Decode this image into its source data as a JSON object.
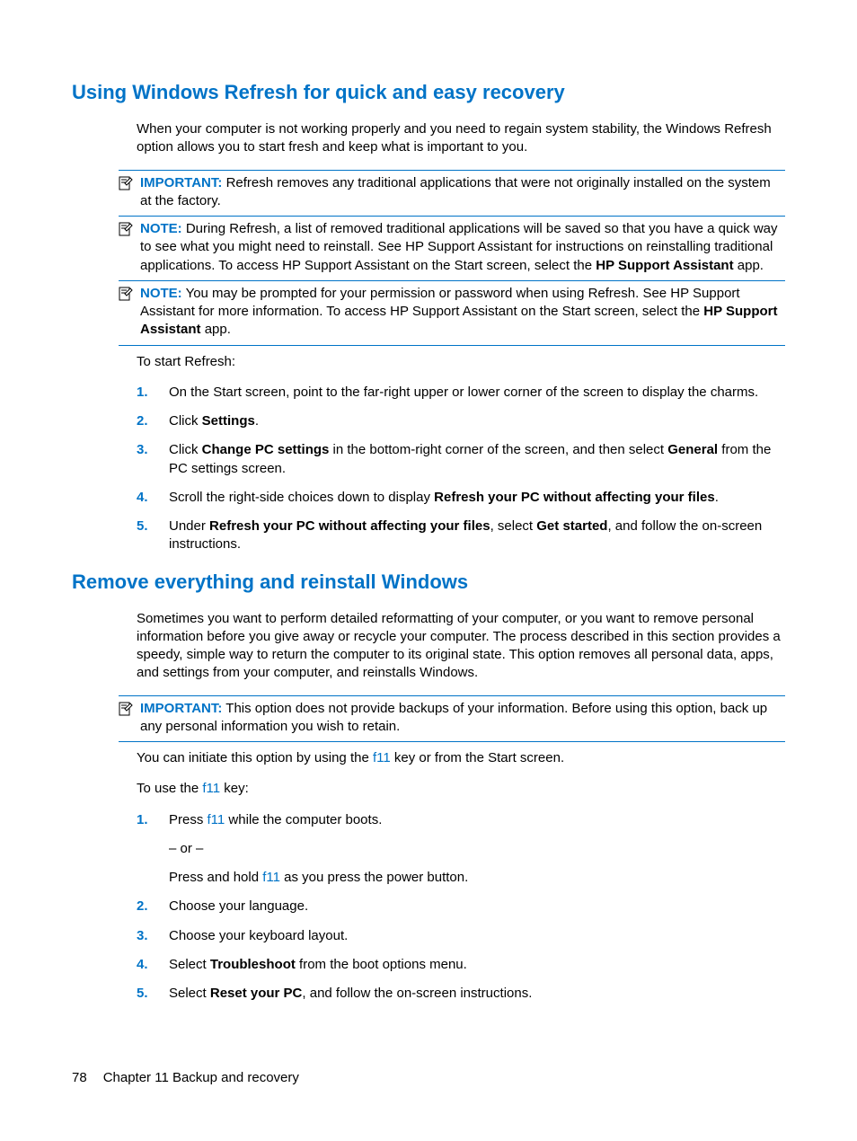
{
  "section1": {
    "heading": "Using Windows Refresh for quick and easy recovery",
    "intro": "When your computer is not working properly and you need to regain system stability, the Windows Refresh option allows you to start fresh and keep what is important to you.",
    "callouts": [
      {
        "label": "IMPORTANT:",
        "text_after": "Refresh removes any traditional applications that were not originally installed on the system at the factory."
      },
      {
        "label": "NOTE:",
        "text_after_part1": "During Refresh, a list of removed traditional applications will be saved so that you have a quick way to see what you might need to reinstall. See HP Support Assistant for instructions on reinstalling traditional applications. To access HP Support Assistant on the Start screen, select the ",
        "bold1": "HP Support Assistant",
        "text_after_part2": " app."
      },
      {
        "label": "NOTE:",
        "text_after_part1": "You may be prompted for your permission or password when using Refresh. See HP Support Assistant for more information. To access HP Support Assistant on the Start screen, select the ",
        "bold1": "HP Support Assistant",
        "text_after_part2": " app."
      }
    ],
    "lead": "To start Refresh:",
    "steps": [
      {
        "pre": "On the Start screen, point to the far-right upper or lower corner of the screen to display the charms."
      },
      {
        "pre": "Click ",
        "b1": "Settings",
        "post": "."
      },
      {
        "pre": "Click ",
        "b1": "Change PC settings",
        "mid": " in the bottom-right corner of the screen, and then select ",
        "b2": "General",
        "post": " from the PC settings screen."
      },
      {
        "pre": "Scroll the right-side choices down to display ",
        "b1": "Refresh your PC without affecting your files",
        "post": "."
      },
      {
        "pre": "Under ",
        "b1": "Refresh your PC without affecting your files",
        "mid": ", select ",
        "b2": "Get started",
        "post": ", and follow the on-screen instructions."
      }
    ]
  },
  "section2": {
    "heading": "Remove everything and reinstall Windows",
    "intro": "Sometimes you want to perform detailed reformatting of your computer, or you want to remove personal information before you give away or recycle your computer. The process described in this section provides a speedy, simple way to return the computer to its original state. This option removes all personal data, apps, and settings from your computer, and reinstalls Windows.",
    "callout": {
      "label": "IMPORTANT:",
      "text_after": "This option does not provide backups of your information. Before using this option, back up any personal information you wish to retain."
    },
    "p_initiate_pre": "You can initiate this option by using the ",
    "key_f11": "f11",
    "p_initiate_post": " key or from the Start screen.",
    "p_touse_pre": "To use the ",
    "p_touse_post": " key:",
    "steps": [
      {
        "pre": "Press ",
        "k1": "f11",
        "post": " while the computer boots.",
        "sub1": "– or –",
        "sub2_pre": "Press and hold ",
        "sub2_k": "f11",
        "sub2_post": " as you press the power button."
      },
      {
        "pre": "Choose your language."
      },
      {
        "pre": "Choose your keyboard layout."
      },
      {
        "pre": "Select ",
        "b1": "Troubleshoot",
        "post": " from the boot options menu."
      },
      {
        "pre": "Select ",
        "b1": "Reset your PC",
        "post": ", and follow the on-screen instructions."
      }
    ]
  },
  "footer": {
    "page": "78",
    "chapter": "Chapter 11   Backup and recovery"
  }
}
